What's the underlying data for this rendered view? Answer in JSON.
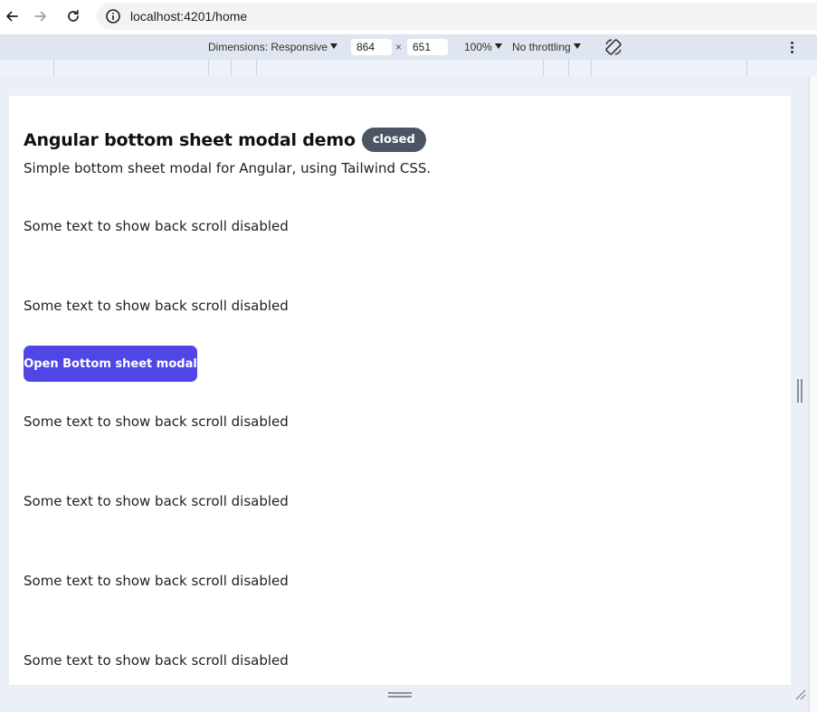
{
  "browser": {
    "back_icon": "arrow-left-icon",
    "forward_icon": "arrow-right-icon",
    "reload_icon": "reload-icon",
    "site_info_icon": "info-circle-icon",
    "url": "localhost:4201/home"
  },
  "device_toolbar": {
    "dimensions_label": "Dimensions: Responsive",
    "width": "864",
    "times": "×",
    "height": "651",
    "zoom": "100%",
    "throttling": "No throttling",
    "rotate_icon": "rotate-device-icon",
    "menu_icon": "more-vertical-icon"
  },
  "page": {
    "title": "Angular bottom sheet modal demo",
    "status_badge": "closed",
    "subtitle": "Simple bottom sheet modal for Angular, using Tailwind CSS.",
    "open_button": "Open Bottom sheet modal",
    "paragraphs_before": [
      "Some text to show back scroll disabled",
      "Some text to show back scroll disabled"
    ],
    "paragraphs_after": [
      "Some text to show back scroll disabled",
      "Some text to show back scroll disabled",
      "Some text to show back scroll disabled",
      "Some text to show back scroll disabled"
    ]
  },
  "colors": {
    "button_bg": "#4f46e5",
    "badge_bg": "#4b5563",
    "toolbar_bg": "#dfe6f1"
  }
}
